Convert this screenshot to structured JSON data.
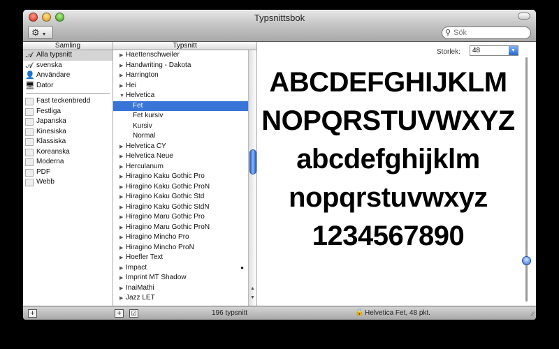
{
  "window": {
    "title": "Typsnittsbok"
  },
  "toolbar": {
    "action_icon": "gear-icon",
    "search_placeholder": "Sök"
  },
  "collections": {
    "header": "Samling",
    "items": [
      {
        "label": "Alla typsnitt",
        "icon": "font-A-icon",
        "selected": true
      },
      {
        "label": "svenska",
        "icon": "font-A-icon"
      },
      {
        "label": "Användare",
        "icon": "user-icon"
      },
      {
        "label": "Dator",
        "icon": "computer-icon"
      }
    ],
    "groups": [
      "Fast teckenbredd",
      "Festliga",
      "Japanska",
      "Kinesiska",
      "Klassiska",
      "Koreanska",
      "Moderna",
      "PDF",
      "Webb"
    ]
  },
  "fonts": {
    "header": "Typsnitt",
    "items": [
      {
        "label": "Haettenschweiler"
      },
      {
        "label": "Handwriting - Dakota"
      },
      {
        "label": "Harrington"
      },
      {
        "label": "Hei"
      },
      {
        "label": "Helvetica",
        "expanded": true
      },
      {
        "label": "Fet",
        "sub": true,
        "selected": true
      },
      {
        "label": "Fet kursiv",
        "sub": true
      },
      {
        "label": "Kursiv",
        "sub": true
      },
      {
        "label": "Normal",
        "sub": true
      },
      {
        "label": "Helvetica CY"
      },
      {
        "label": "Helvetica Neue"
      },
      {
        "label": "Herculanum"
      },
      {
        "label": "Hiragino Kaku Gothic Pro"
      },
      {
        "label": "Hiragino Kaku Gothic ProN"
      },
      {
        "label": "Hiragino Kaku Gothic Std"
      },
      {
        "label": "Hiragino Kaku Gothic StdN"
      },
      {
        "label": "Hiragino Maru Gothic Pro"
      },
      {
        "label": "Hiragino Maru Gothic ProN"
      },
      {
        "label": "Hiragino Mincho Pro"
      },
      {
        "label": "Hiragino Mincho ProN"
      },
      {
        "label": "Hoefler Text"
      },
      {
        "label": "Impact",
        "dot": true
      },
      {
        "label": "Imprint MT Shadow"
      },
      {
        "label": "InaiMathi"
      },
      {
        "label": "Jazz LET"
      }
    ]
  },
  "preview": {
    "size_label": "Storlek:",
    "size_value": "48",
    "lines": [
      "ABCDEFGHIJKLM",
      "NOPQRSTUVWXYZ",
      "abcdefghijklm",
      "nopqrstuvwxyz",
      "1234567890"
    ],
    "size_slider_fraction": 0.13
  },
  "status": {
    "count": "196 typsnitt",
    "info": "Helvetica Fet, 48 pkt."
  }
}
